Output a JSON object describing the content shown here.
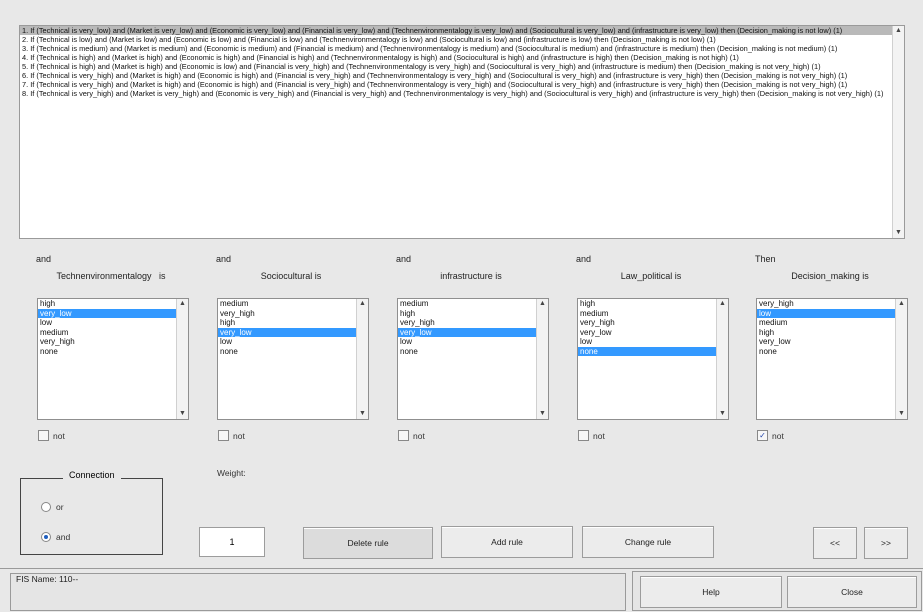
{
  "rules": {
    "lines": [
      "1. If (Technical is very_low) and (Market is very_low) and (Economic is very_low) and (Financial is very_low) and (Technenvironmentalogy   is very_low) and (Sociocultural is very_low) and (infrastructure is very_low) then (Decision_making is not low) (1)",
      "2. If (Technical is low) and (Market is low) and (Economic is low) and (Financial is low) and (Technenvironmentalogy   is low) and (Sociocultural is low) and (infrastructure is low) then (Decision_making is not low) (1)",
      "3. If (Technical is medium) and (Market is medium) and (Economic is medium) and (Financial is medium) and (Technenvironmentalogy   is medium) and (Sociocultural is medium) and (infrastructure is medium) then (Decision_making is not medium) (1)",
      "4. If (Technical is high) and (Market is high) and (Economic is high) and (Financial is high) and (Technenvironmentalogy   is high) and (Sociocultural is high) and (infrastructure is high) then (Decision_making is not high) (1)",
      "5. If (Technical is high) and (Market is high) and (Economic is low) and (Financial is very_high) and (Technenvironmentalogy   is very_high) and (Sociocultural is very_high) and (infrastructure is medium) then (Decision_making is not very_high) (1)",
      "6. If (Technical is very_high) and (Market is high) and (Economic is high) and (Financial is very_high) and (Technenvironmentalogy   is very_high) and (Sociocultural is very_high) and (infrastructure is very_high) then (Decision_making is not very_high) (1)",
      "7. If (Technical is very_high) and (Market is high) and (Economic is high) and (Financial is very_high) and (Technenvironmentalogy   is very_high) and (Sociocultural is very_high) and (infrastructure is very_high) then (Decision_making is not very_high) (1)",
      "8. If (Technical is very_high) and (Market is very_high) and (Economic is very_high) and (Financial is very_high) and (Technenvironmentalogy   is very_high) and (Sociocultural is very_high) and (infrastructure is very_high) then (Decision_making is not very_high) (1)"
    ],
    "selected_index": 0
  },
  "columns": [
    {
      "connector": "and",
      "title": "Technenvironmentalogy   is",
      "options": [
        "high",
        "very_low",
        "low",
        "medium",
        "very_high",
        "none"
      ],
      "selected": "very_low",
      "not_label": "not",
      "not_checked": false
    },
    {
      "connector": "and",
      "title": "Sociocultural is",
      "options": [
        "medium",
        "very_high",
        "high",
        "very_low",
        "low",
        "none"
      ],
      "selected": "very_low",
      "not_label": "not",
      "not_checked": false
    },
    {
      "connector": "and",
      "title": "infrastructure is",
      "options": [
        "medium",
        "high",
        "very_high",
        "very_low",
        "low",
        "none"
      ],
      "selected": "very_low",
      "not_label": "not",
      "not_checked": false
    },
    {
      "connector": "and",
      "title": "Law_political is",
      "options": [
        "high",
        "medium",
        "very_high",
        "very_low",
        "low",
        "none"
      ],
      "selected": "none",
      "not_label": "not",
      "not_checked": false
    },
    {
      "connector": "Then",
      "title": "Decision_making is",
      "options": [
        "very_high",
        "low",
        "medium",
        "high",
        "very_low",
        "none"
      ],
      "selected": "low",
      "not_label": "not",
      "not_checked": true
    }
  ],
  "connection": {
    "label": "Connection",
    "options": [
      "or",
      "and"
    ],
    "selected": "and"
  },
  "weight": {
    "label": "Weight:",
    "value": "1"
  },
  "buttons": {
    "delete_rule": "Delete rule",
    "add_rule": "Add rule",
    "change_rule": "Change rule",
    "prev": "<<",
    "next": ">>",
    "help": "Help",
    "close": "Close"
  },
  "status": {
    "fis_name": "FIS Name: 110--"
  },
  "colors": {
    "selection": "#3399ff",
    "rule_selection": "#b9b9b9",
    "background": "#e8e8e8"
  }
}
